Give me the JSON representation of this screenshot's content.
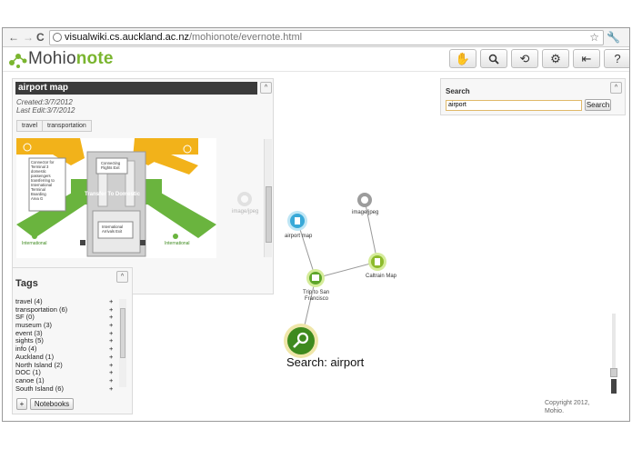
{
  "browser": {
    "url_host": "visualwiki.cs.auckland.ac.nz",
    "url_path": "/mohionote/evernote.html"
  },
  "app": {
    "logo_part1": "Mohio",
    "logo_part2": "note",
    "toolbar_icons": [
      "evernote-icon",
      "search-icon",
      "refresh-icon",
      "gear-icon",
      "logout-icon",
      "help-icon"
    ],
    "help_label": "?"
  },
  "note": {
    "title": "airport map",
    "created": "Created:3/7/2012",
    "last_edit": "Last Edit:3/7/2012",
    "tags": [
      "travel",
      "transportation"
    ],
    "collapse_label": "^",
    "map_labels": {
      "connector": "Connector for Terminal 3 domestic passengers transferring to International Terminal Boarding Area G",
      "connecting_flights": "Connecting Flights Exit",
      "transfer": "Transfer To Domestic",
      "arrivals": "International Arrivals Exit",
      "international_left": "International",
      "international_right": "International"
    }
  },
  "tags_panel": {
    "title": "Tags",
    "items": [
      {
        "label": "travel (4)"
      },
      {
        "label": "transportation (6)"
      },
      {
        "label": "SF (0)"
      },
      {
        "label": "museum (3)"
      },
      {
        "label": "event (3)"
      },
      {
        "label": "sights (5)"
      },
      {
        "label": "info (4)"
      },
      {
        "label": "Auckland (1)"
      },
      {
        "label": "North Island (2)"
      },
      {
        "label": "DOC (1)"
      },
      {
        "label": "canoe (1)"
      },
      {
        "label": "South Island (6)"
      }
    ],
    "plus": "+",
    "add_label": "+",
    "notebooks_label": "Notebooks"
  },
  "search": {
    "title": "Search",
    "value": "airport",
    "button_label": "Search"
  },
  "graph": {
    "nodes": [
      {
        "label": "image/jpeg"
      },
      {
        "label": "airport map"
      },
      {
        "label": "image/jpeg"
      },
      {
        "label": "Caltrain Map"
      },
      {
        "label": "Trip to San Francisco"
      },
      {
        "label": "Search: airport"
      }
    ]
  },
  "footer": {
    "copyright_line1": "Copyright 2012,",
    "copyright_line2": "Mohio."
  }
}
